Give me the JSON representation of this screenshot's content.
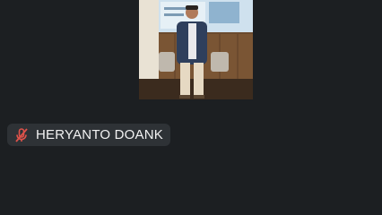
{
  "participant": {
    "name": "HERYANTO DOANK",
    "mic_icon": "mic-muted-icon",
    "mic_status_color": "#e0524a"
  },
  "colors": {
    "background": "#1c1f22",
    "pill_background": "#2e3236",
    "text": "#f2f2f2"
  }
}
